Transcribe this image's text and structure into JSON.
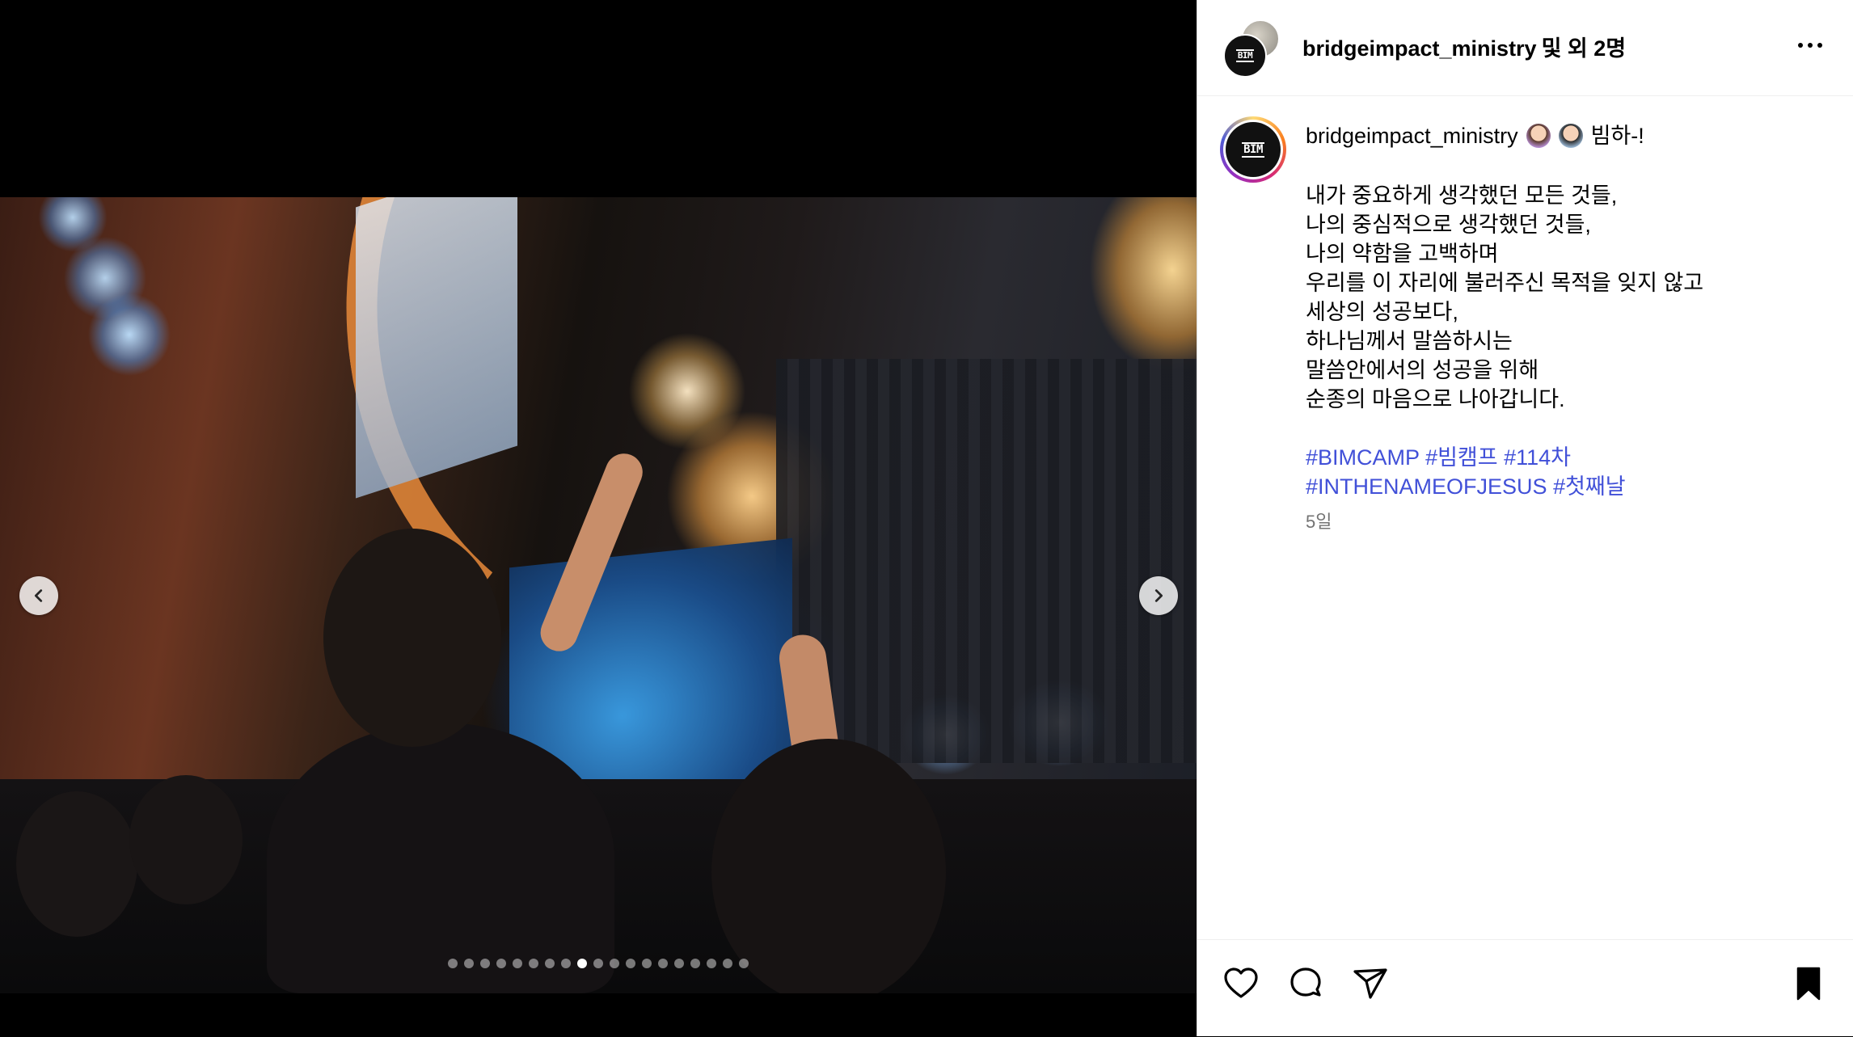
{
  "post_header": {
    "username": "bridgeimpact_ministry",
    "collaborators_suffix": "및 외 2명"
  },
  "caption": {
    "username": "bridgeimpact_ministry",
    "emojis": [
      "woman-technologist-emoji",
      "man-technologist-emoji"
    ],
    "headline": "빔하-!",
    "lines": [
      "내가 중요하게 생각했던 모든 것들,",
      "나의 중심적으로 생각했던 것들,",
      "나의 약함을 고백하며",
      "우리를 이 자리에 불러주신 목적을 잊지 않고",
      "세상의 성공보다,",
      "하나님께서 말씀하시는",
      "말씀안에서의 성공을 위해",
      "순종의 마음으로 나아갑니다."
    ],
    "hashtags_line1": [
      "#BIMCAMP",
      "#빔캠프",
      "#114차"
    ],
    "hashtags_line2": [
      "#INTHENAMEOFJESUS",
      "#첫째날"
    ],
    "time_ago": "5일"
  },
  "carousel": {
    "slide_count": 19,
    "active_index": 8,
    "prev_icon": "chevron-left-icon",
    "next_icon": "chevron-right-icon"
  },
  "actions": {
    "like_icon": "heart-icon",
    "comment_icon": "comment-icon",
    "share_icon": "send-icon",
    "save_icon": "bookmark-icon"
  },
  "colors": {
    "hashtag": "#4150d8",
    "muted": "#737373",
    "accent_ring": [
      "#feda75",
      "#fa7e1e",
      "#d62976",
      "#962fbf",
      "#4f5bd5"
    ]
  }
}
